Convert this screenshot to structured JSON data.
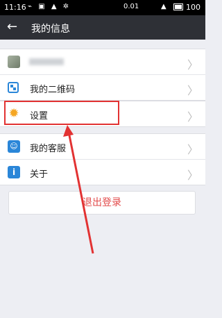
{
  "status_bar": {
    "time": "11:16",
    "battery_text": "0.01",
    "percent_value": "100"
  },
  "header": {
    "title": "我的信息",
    "back_icon": "back-arrow-icon"
  },
  "rows": {
    "qr_label": "我的二维码",
    "settings_label": "设置",
    "service_label": "我的客服",
    "about_label": "关于"
  },
  "logout_label": "退出登录",
  "colors": {
    "title_bar": "#2e3036",
    "accent_blue": "#2a86d8",
    "gear": "#f5a622",
    "danger": "#e24a4a"
  }
}
